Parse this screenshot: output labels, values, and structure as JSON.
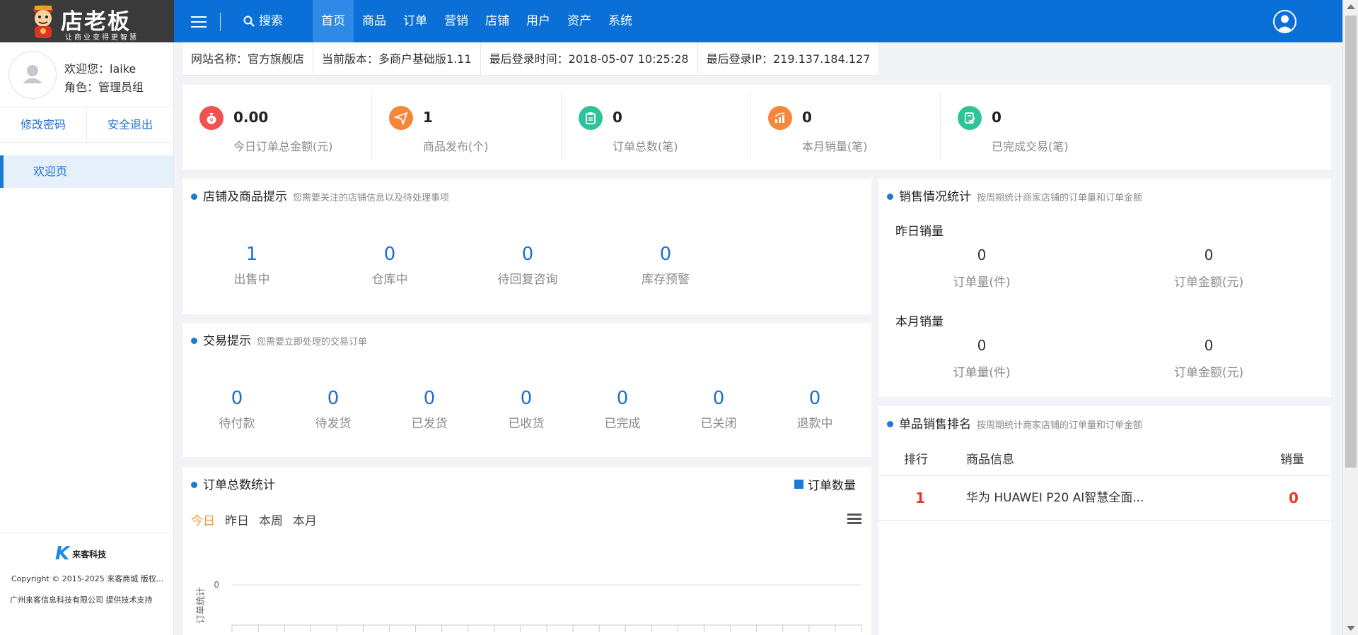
{
  "logo": {
    "brand": "店老板",
    "slogan": "让商业变得更智慧"
  },
  "topbar": {
    "search_label": "搜索",
    "nav": [
      "首页",
      "商品",
      "订单",
      "营销",
      "店铺",
      "用户",
      "资产",
      "系统"
    ],
    "active_nav": "首页",
    "accent_color": "#0a6fd6"
  },
  "sidebar": {
    "welcome": "欢迎您：laike",
    "role": "角色：管理员组",
    "change_password": "修改密码",
    "logout": "安全退出",
    "nav_items": [
      "欢迎页"
    ],
    "footer_brand": "来客科技",
    "copyright": "Copyright © 2015-2025 来客商城 版权...",
    "support": "广州来客信息科技有限公司 提供技术支持"
  },
  "infobar": {
    "site_name": "网站名称：官方旗舰店",
    "version": "当前版本：多商户基础版1.11",
    "last_login_time": "最后登录时间：2018-05-07 10:25:28",
    "last_login_ip": "最后登录IP：219.137.184.127"
  },
  "stats": [
    {
      "value": "0.00",
      "label": "今日订单总金额(元)",
      "icon": "money-bag-icon",
      "color": "#ef5350"
    },
    {
      "value": "1",
      "label": "商品发布(个)",
      "icon": "paper-plane-icon",
      "color": "#f4873a"
    },
    {
      "value": "0",
      "label": "订单总数(笔)",
      "icon": "clipboard-icon",
      "color": "#2fc39a"
    },
    {
      "value": "0",
      "label": "本月销量(笔)",
      "icon": "bar-chart-icon",
      "color": "#f4873a"
    },
    {
      "value": "0",
      "label": "已完成交易(笔)",
      "icon": "checklist-icon",
      "color": "#2fc39a"
    }
  ],
  "shop_panel": {
    "title": "店铺及商品提示",
    "desc": "您需要关注的店铺信息以及待处理事项",
    "metrics": [
      {
        "value": "1",
        "label": "出售中"
      },
      {
        "value": "0",
        "label": "仓库中"
      },
      {
        "value": "0",
        "label": "待回复咨询"
      },
      {
        "value": "0",
        "label": "库存预警"
      }
    ]
  },
  "trade_panel": {
    "title": "交易提示",
    "desc": "您需要立即处理的交易订单",
    "metrics": [
      {
        "value": "0",
        "label": "待付款"
      },
      {
        "value": "0",
        "label": "待发货"
      },
      {
        "value": "0",
        "label": "已发货"
      },
      {
        "value": "0",
        "label": "已收货"
      },
      {
        "value": "0",
        "label": "已完成"
      },
      {
        "value": "0",
        "label": "已关闭"
      },
      {
        "value": "0",
        "label": "退款中"
      }
    ]
  },
  "order_chart": {
    "title": "订单总数统计",
    "legend": "订单数量",
    "tabs": [
      "今日",
      "昨日",
      "本周",
      "本月"
    ],
    "active_tab": "今日"
  },
  "chart_data": {
    "type": "bar",
    "title": "订单总数统计",
    "ylabel": "订单统计",
    "xlabel": "",
    "y_ticks": [
      "0"
    ],
    "series": [
      {
        "name": "订单数量",
        "values": []
      }
    ],
    "legend_position": "top-right",
    "grid": true
  },
  "sales_panel": {
    "title": "销售情况统计",
    "desc": "按周期统计商家店铺的订单量和订单金额",
    "groups": [
      {
        "name": "昨日销量",
        "qty": "0",
        "qty_label": "订单量(件)",
        "amount": "0",
        "amount_label": "订单金额(元)"
      },
      {
        "name": "本月销量",
        "qty": "0",
        "qty_label": "订单量(件)",
        "amount": "0",
        "amount_label": "订单金额(元)"
      }
    ]
  },
  "rank_panel": {
    "title": "单品销售排名",
    "desc": "按周期统计商家店铺的订单量和订单金额",
    "headers": {
      "rank": "排行",
      "info": "商品信息",
      "sales": "销量"
    },
    "rows": [
      {
        "rank": "1",
        "name": "华为 HUAWEI P20 AI智慧全面...",
        "sales": "0"
      }
    ]
  }
}
